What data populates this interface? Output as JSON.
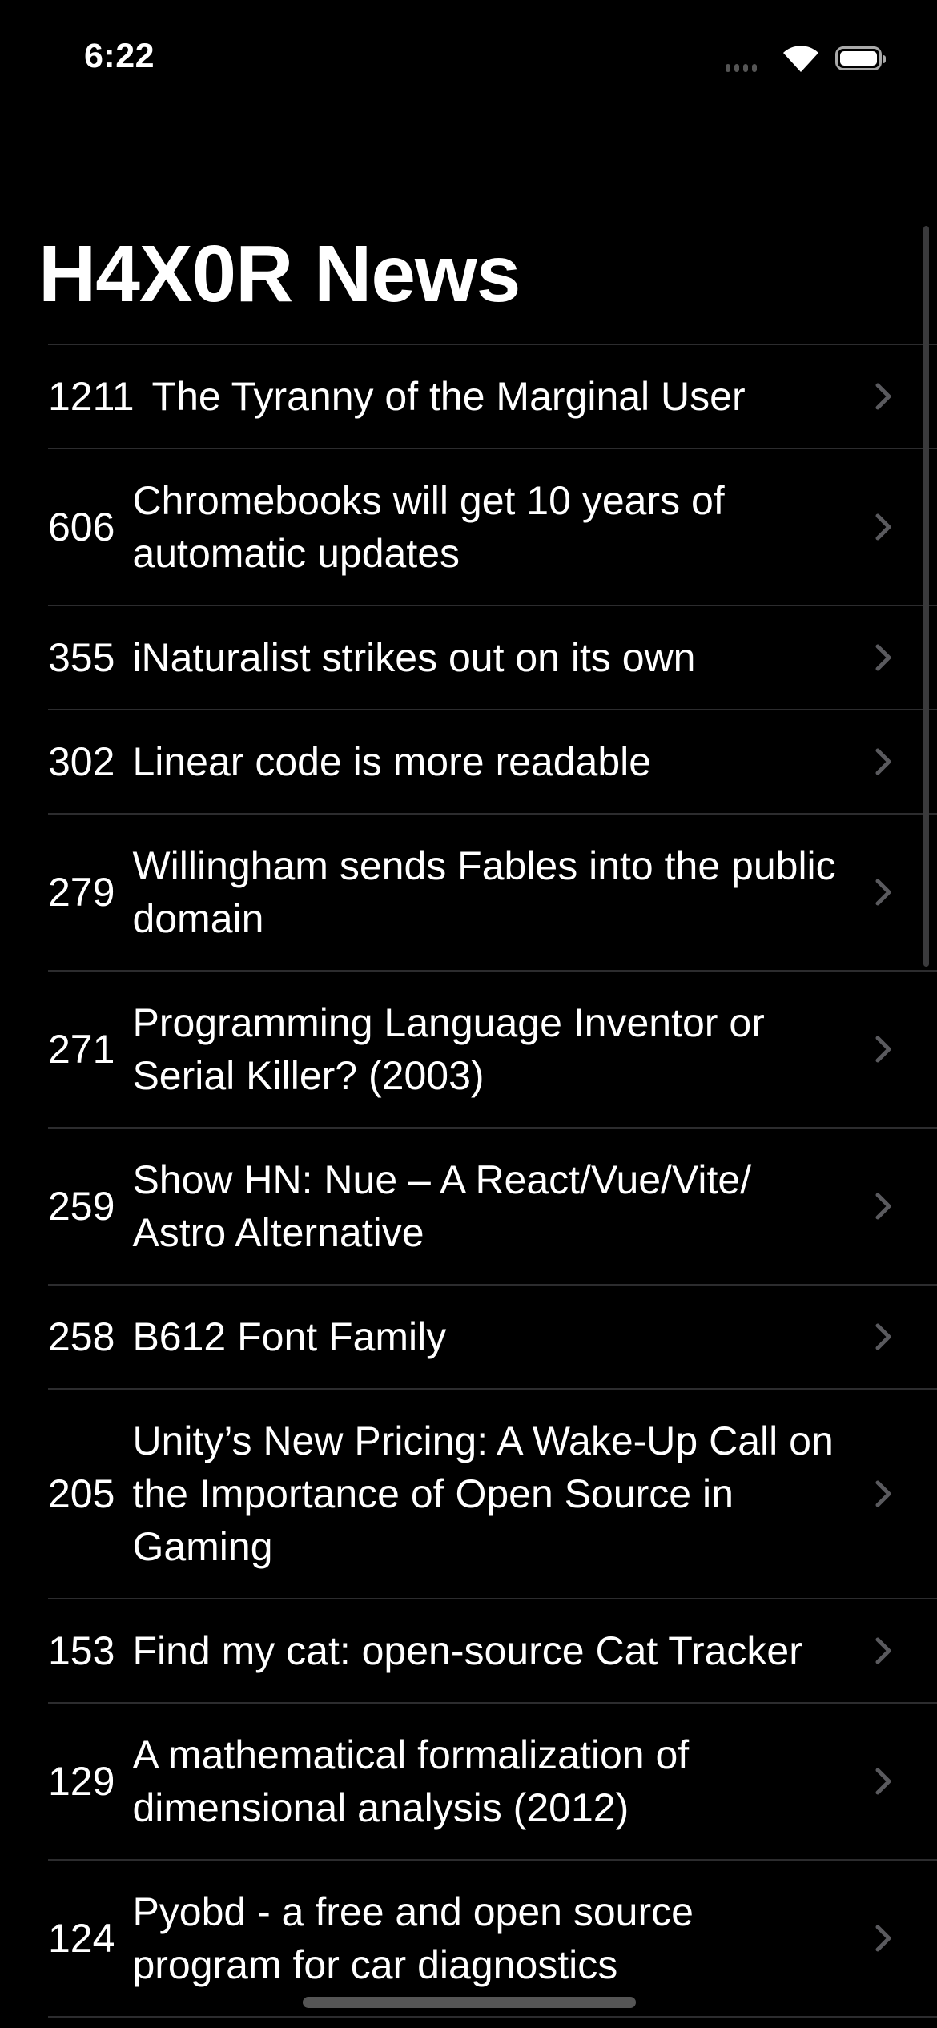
{
  "status_bar": {
    "time": "6:22"
  },
  "nav": {
    "title": "H4X0R News"
  },
  "posts": [
    {
      "points": "1211",
      "title": "The Tyranny of the Marginal User"
    },
    {
      "points": "606",
      "title": "Chromebooks will get 10 years of automatic updates"
    },
    {
      "points": "355",
      "title": "iNaturalist strikes out on its own"
    },
    {
      "points": "302",
      "title": "Linear code is more readable"
    },
    {
      "points": "279",
      "title": "Willingham sends Fables into the public domain"
    },
    {
      "points": "271",
      "title": "Programming Language Inventor or Serial Killer? (2003)"
    },
    {
      "points": "259",
      "title": "Show HN: Nue – A React/Vue/Vite/ Astro Alternative"
    },
    {
      "points": "258",
      "title": "B612 Font Family"
    },
    {
      "points": "205",
      "title": "Unity’s New Pricing: A Wake-Up Call on the Importance of Open Source in Gaming"
    },
    {
      "points": "153",
      "title": "Find my cat: open-source Cat Tracker"
    },
    {
      "points": "129",
      "title": "A mathematical formalization of dimensional analysis (2012)"
    },
    {
      "points": "124",
      "title": "Pyobd - a free and open source program for car diagnostics"
    }
  ]
}
